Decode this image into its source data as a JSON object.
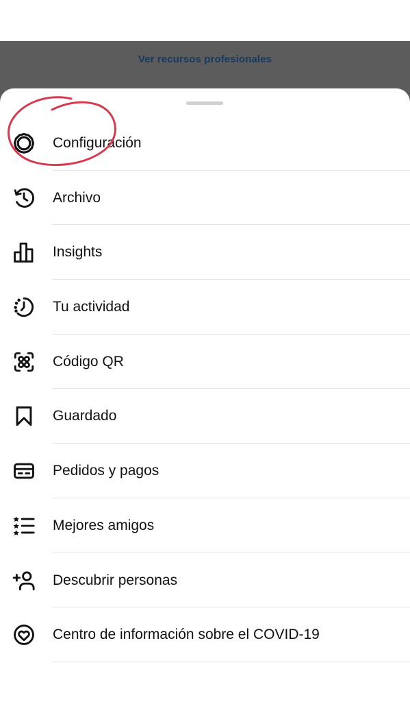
{
  "background": {
    "link_label": "Ver recursos profesionales"
  },
  "menu": {
    "items": [
      {
        "label": "Configuración",
        "icon": "gear-icon"
      },
      {
        "label": "Archivo",
        "icon": "archive-history-icon"
      },
      {
        "label": "Insights",
        "icon": "bar-chart-icon"
      },
      {
        "label": "Tu actividad",
        "icon": "activity-clock-icon"
      },
      {
        "label": "Código QR",
        "icon": "qr-code-icon"
      },
      {
        "label": "Guardado",
        "icon": "bookmark-icon"
      },
      {
        "label": "Pedidos y pagos",
        "icon": "credit-card-icon"
      },
      {
        "label": "Mejores amigos",
        "icon": "close-friends-list-icon"
      },
      {
        "label": "Descubrir personas",
        "icon": "add-person-icon"
      },
      {
        "label": "Centro de información sobre el COVID-19",
        "icon": "heart-globe-icon"
      }
    ]
  },
  "colors": {
    "annotation_red": "#d63a4e",
    "dim_overlay": "#5c5c5c",
    "link_blue": "#163a5e"
  }
}
